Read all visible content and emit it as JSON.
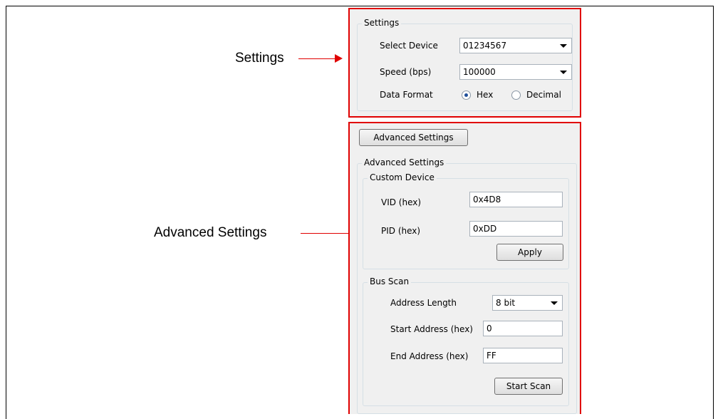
{
  "callouts": {
    "settings": "Settings",
    "advanced": "Advanced Settings"
  },
  "settings": {
    "group_title": "Settings",
    "select_device_label": "Select Device",
    "select_device_value": "01234567",
    "speed_label": "Speed (bps)",
    "speed_value": "100000",
    "data_format_label": "Data Format",
    "format_hex": "Hex",
    "format_decimal": "Decimal",
    "selected_format": "Hex"
  },
  "advanced": {
    "toggle_button": "Advanced Settings",
    "group_title": "Advanced Settings",
    "custom_device": {
      "title": "Custom Device",
      "vid_label": "VID (hex)",
      "vid_value": "0x4D8",
      "pid_label": "PID (hex)",
      "pid_value": "0xDD",
      "apply_button": "Apply"
    },
    "bus_scan": {
      "title": "Bus Scan",
      "address_length_label": "Address Length",
      "address_length_value": "8 bit",
      "start_label": "Start Address (hex)",
      "start_value": "0",
      "end_label": "End Address (hex)",
      "end_value": "FF",
      "scan_button": "Start Scan"
    }
  },
  "colors": {
    "highlight": "#e00000",
    "panel_bg": "#f0f0f0"
  }
}
